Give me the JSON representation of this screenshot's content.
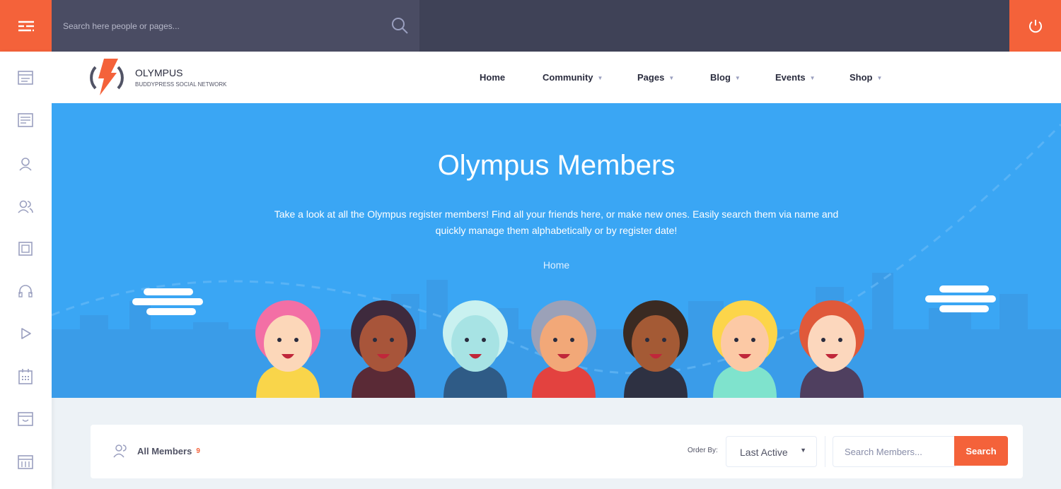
{
  "topbar": {
    "search_placeholder": "Search here people or pages..."
  },
  "brand": {
    "name": "OLYMPUS",
    "tagline": "BUDDYPRESS SOCIAL NETWORK"
  },
  "nav": [
    {
      "label": "Home"
    },
    {
      "label": "Community"
    },
    {
      "label": "Pages"
    },
    {
      "label": "Blog"
    },
    {
      "label": "Events"
    },
    {
      "label": "Shop"
    }
  ],
  "hero": {
    "title": "Olympus Members",
    "description": "Take a look at all the Olympus register members! Find all your friends here, or make new ones. Easily search them via name and quickly manage them alphabetically or by register date!",
    "breadcrumb": "Home"
  },
  "members_bar": {
    "label": "All Members",
    "count": "9",
    "order_by_label": "Order By:",
    "order_by_value": "Last Active",
    "search_placeholder": "Search Members...",
    "search_button": "Search"
  },
  "colors": {
    "accent": "#f4623a",
    "topbar": "#3f4257",
    "hero": "#3aa6f4"
  }
}
